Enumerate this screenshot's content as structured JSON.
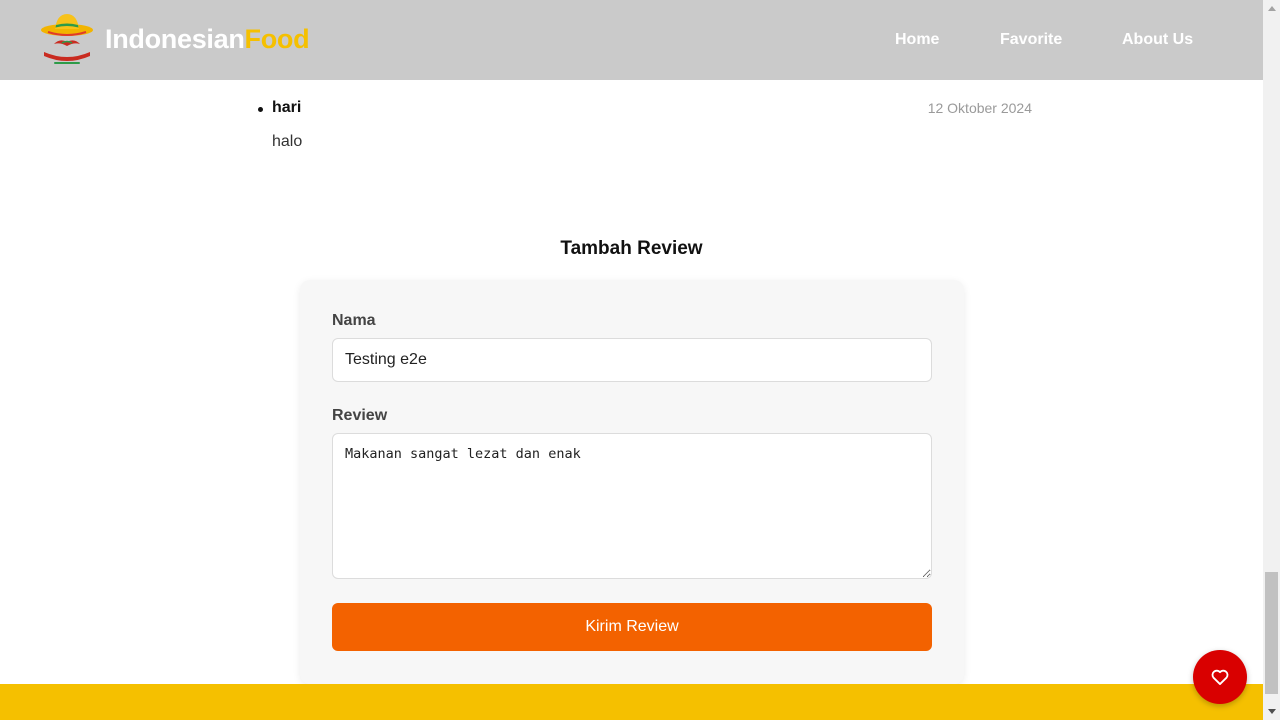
{
  "header": {
    "brand_part1": "Indonesian",
    "brand_part2": "Food",
    "logo_name": "indonesian-food-logo",
    "nav": {
      "home": "Home",
      "favorite": "Favorite",
      "about": "About Us"
    }
  },
  "reviews": [
    {
      "name": "",
      "date": "",
      "text": ""
    },
    {
      "name": "hari",
      "date": "12 Oktober 2024",
      "text": "halo"
    }
  ],
  "form": {
    "title": "Tambah Review",
    "name_label": "Nama",
    "name_value": "Testing e2e",
    "review_label": "Review",
    "review_value": "Makanan sangat lezat dan enak",
    "submit_label": "Kirim Review"
  },
  "icons": {
    "fab": "heart-icon"
  },
  "colors": {
    "brand_accent": "#f5c000",
    "submit_button": "#f36200",
    "fab_button": "#d90000",
    "footer": "#f5c000"
  }
}
